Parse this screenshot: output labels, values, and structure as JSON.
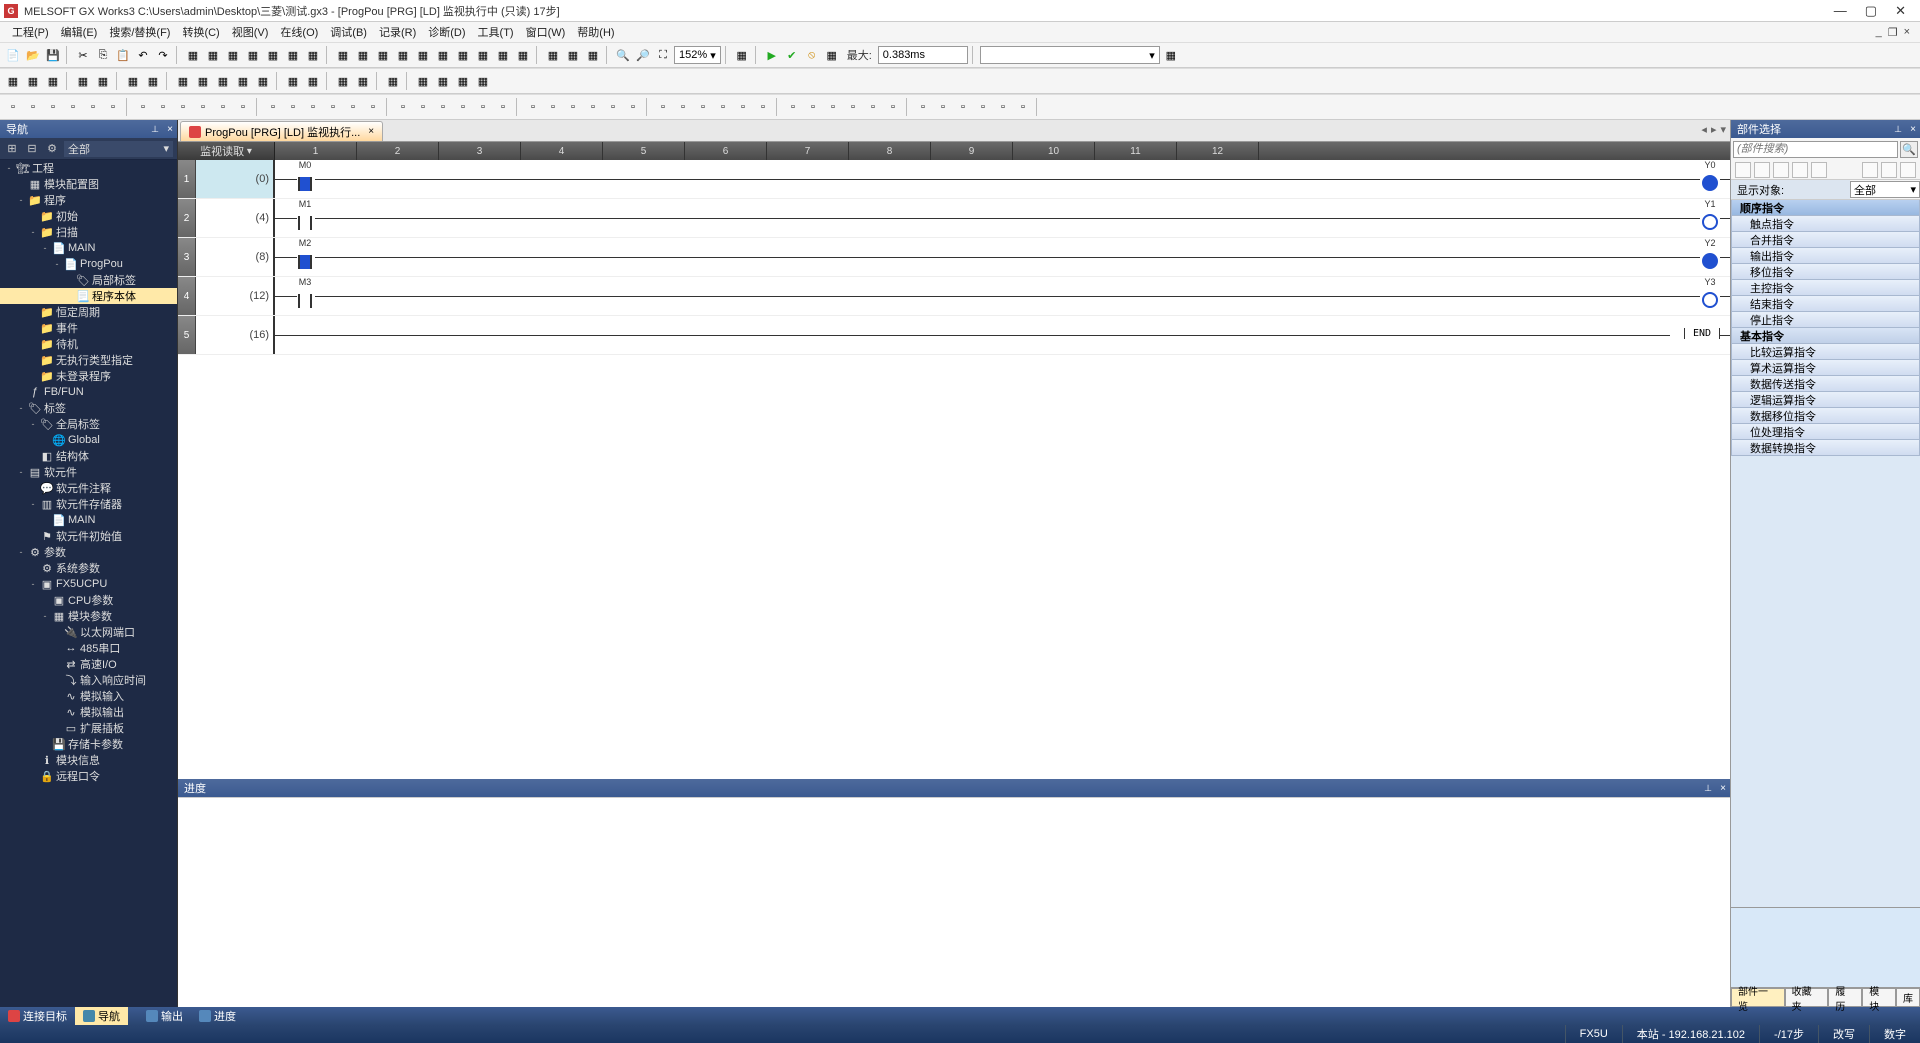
{
  "title": "MELSOFT GX Works3 C:\\Users\\admin\\Desktop\\三菱\\测试.gx3 - [ProgPou [PRG] [LD] 监视执行中 (只读) 17步]",
  "menu": [
    "工程(P)",
    "编辑(E)",
    "搜索/替换(F)",
    "转换(C)",
    "视图(V)",
    "在线(O)",
    "调试(B)",
    "记录(R)",
    "诊断(D)",
    "工具(T)",
    "窗口(W)",
    "帮助(H)"
  ],
  "zoom": "152%",
  "scantime_label": "最大:",
  "scantime": "0.383ms",
  "nav": {
    "title": "导航",
    "filter": "全部",
    "tree": [
      {
        "d": 0,
        "exp": "-",
        "i": "prj",
        "t": "工程"
      },
      {
        "d": 1,
        "exp": "",
        "i": "mod",
        "t": "模块配置图"
      },
      {
        "d": 1,
        "exp": "-",
        "i": "fld",
        "t": "程序"
      },
      {
        "d": 2,
        "exp": "",
        "i": "fld",
        "t": "初始"
      },
      {
        "d": 2,
        "exp": "-",
        "i": "fld",
        "t": "扫描"
      },
      {
        "d": 3,
        "exp": "-",
        "i": "pou",
        "t": "MAIN"
      },
      {
        "d": 4,
        "exp": "-",
        "i": "pou",
        "t": "ProgPou"
      },
      {
        "d": 5,
        "exp": "",
        "i": "lbl",
        "t": "局部标签"
      },
      {
        "d": 5,
        "exp": "",
        "i": "bdy",
        "t": "程序本体",
        "sel": true
      },
      {
        "d": 2,
        "exp": "",
        "i": "fld",
        "t": "恒定周期"
      },
      {
        "d": 2,
        "exp": "",
        "i": "fld",
        "t": "事件"
      },
      {
        "d": 2,
        "exp": "",
        "i": "fld",
        "t": "待机"
      },
      {
        "d": 2,
        "exp": "",
        "i": "fld",
        "t": "无执行类型指定"
      },
      {
        "d": 2,
        "exp": "",
        "i": "fld",
        "t": "未登录程序"
      },
      {
        "d": 1,
        "exp": "",
        "i": "fb",
        "t": "FB/FUN"
      },
      {
        "d": 1,
        "exp": "-",
        "i": "lbl",
        "t": "标签"
      },
      {
        "d": 2,
        "exp": "-",
        "i": "lbl",
        "t": "全局标签"
      },
      {
        "d": 3,
        "exp": "",
        "i": "glb",
        "t": "Global"
      },
      {
        "d": 2,
        "exp": "",
        "i": "str",
        "t": "结构体"
      },
      {
        "d": 1,
        "exp": "-",
        "i": "dev",
        "t": "软元件"
      },
      {
        "d": 2,
        "exp": "",
        "i": "cmt",
        "t": "软元件注释"
      },
      {
        "d": 2,
        "exp": "-",
        "i": "mem",
        "t": "软元件存储器"
      },
      {
        "d": 3,
        "exp": "",
        "i": "pou",
        "t": "MAIN"
      },
      {
        "d": 2,
        "exp": "",
        "i": "ini",
        "t": "软元件初始值"
      },
      {
        "d": 1,
        "exp": "-",
        "i": "par",
        "t": "参数"
      },
      {
        "d": 2,
        "exp": "",
        "i": "sys",
        "t": "系统参数"
      },
      {
        "d": 2,
        "exp": "-",
        "i": "cpu",
        "t": "FX5UCPU"
      },
      {
        "d": 3,
        "exp": "",
        "i": "cpu",
        "t": "CPU参数"
      },
      {
        "d": 3,
        "exp": "-",
        "i": "mod",
        "t": "模块参数"
      },
      {
        "d": 4,
        "exp": "",
        "i": "eth",
        "t": "以太网端口"
      },
      {
        "d": 4,
        "exp": "",
        "i": "ser",
        "t": "485串口"
      },
      {
        "d": 4,
        "exp": "",
        "i": "io",
        "t": "高速I/O"
      },
      {
        "d": 4,
        "exp": "",
        "i": "inp",
        "t": "输入响应时间"
      },
      {
        "d": 4,
        "exp": "",
        "i": "ai",
        "t": "模拟输入"
      },
      {
        "d": 4,
        "exp": "",
        "i": "ao",
        "t": "模拟输出"
      },
      {
        "d": 4,
        "exp": "",
        "i": "ext",
        "t": "扩展插板"
      },
      {
        "d": 3,
        "exp": "",
        "i": "sd",
        "t": "存储卡参数"
      },
      {
        "d": 2,
        "exp": "",
        "i": "inf",
        "t": "模块信息"
      },
      {
        "d": 2,
        "exp": "",
        "i": "rmt",
        "t": "远程口令"
      }
    ]
  },
  "tab": {
    "label": "ProgPou [PRG] [LD] 监视执行..."
  },
  "ladder": {
    "corner": "监视读取",
    "cols": [
      "1",
      "2",
      "3",
      "4",
      "5",
      "6",
      "7",
      "8",
      "9",
      "10",
      "11",
      "12"
    ],
    "rungs": [
      {
        "n": "1",
        "step": "(0)",
        "c": {
          "lbl": "M0",
          "on": true
        },
        "o": {
          "lbl": "Y0",
          "on": true
        },
        "sel": true
      },
      {
        "n": "2",
        "step": "(4)",
        "c": {
          "lbl": "M1",
          "on": false
        },
        "o": {
          "lbl": "Y1",
          "on": false
        }
      },
      {
        "n": "3",
        "step": "(8)",
        "c": {
          "lbl": "M2",
          "on": true
        },
        "o": {
          "lbl": "Y2",
          "on": true
        }
      },
      {
        "n": "4",
        "step": "(12)",
        "c": {
          "lbl": "M3",
          "on": false
        },
        "o": {
          "lbl": "Y3",
          "on": false
        }
      },
      {
        "n": "5",
        "step": "(16)",
        "end": "END"
      }
    ]
  },
  "progress_title": "进度",
  "parts": {
    "title": "部件选择",
    "search_ph": "(部件搜索)",
    "filter_label": "显示对象:",
    "filter_value": "全部",
    "cats": [
      {
        "t": "顺序指令",
        "grp": true,
        "sel": true
      },
      {
        "t": "触点指令"
      },
      {
        "t": "合并指令"
      },
      {
        "t": "输出指令"
      },
      {
        "t": "移位指令"
      },
      {
        "t": "主控指令"
      },
      {
        "t": "结束指令"
      },
      {
        "t": "停止指令"
      },
      {
        "t": "基本指令",
        "grp": true
      },
      {
        "t": "比较运算指令"
      },
      {
        "t": "算术运算指令"
      },
      {
        "t": "数据传送指令"
      },
      {
        "t": "逻辑运算指令"
      },
      {
        "t": "数据移位指令"
      },
      {
        "t": "位处理指令"
      },
      {
        "t": "数据转换指令"
      }
    ],
    "tabs": [
      "部件一览",
      "收藏夹",
      "履历",
      "模块",
      "库"
    ]
  },
  "bottom": {
    "tabs": [
      "连接目标",
      "导航"
    ],
    "outtabs": [
      "输出",
      "进度"
    ]
  },
  "status": {
    "cpu": "FX5U",
    "host": "本站 - 192.168.21.102",
    "steps": "-/17步",
    "mode": "改写",
    "caps": "数字"
  }
}
